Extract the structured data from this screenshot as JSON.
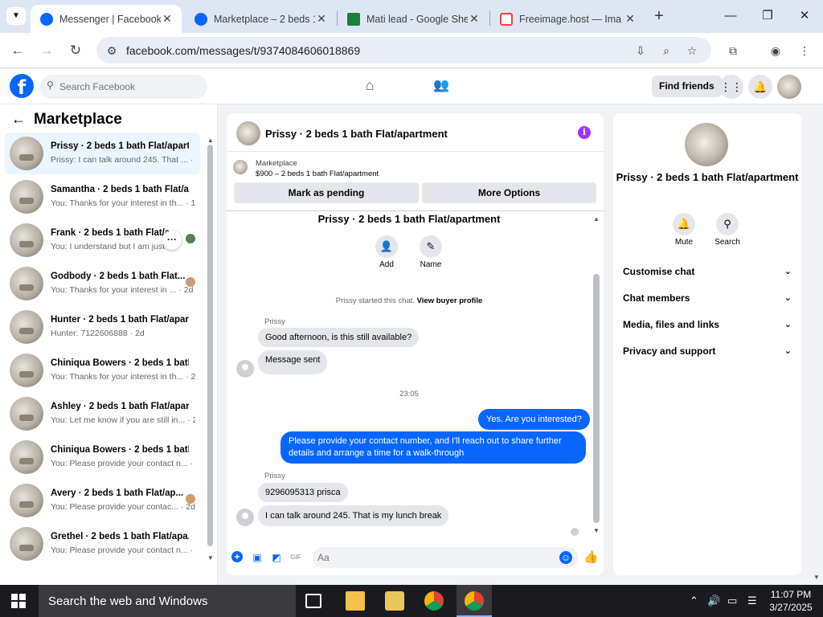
{
  "browser": {
    "tabs": [
      {
        "title": "Messenger | Facebook",
        "active": true,
        "favicon_color": "#0866ff"
      },
      {
        "title": "Marketplace – 2 beds 1",
        "active": false,
        "favicon_color": "#0866ff"
      },
      {
        "title": "Mati lead - Google She",
        "active": false,
        "favicon_color": "#188038"
      },
      {
        "title": "Freeimage.host — Ima",
        "active": false,
        "favicon_color": "#e8453c"
      }
    ],
    "url": "facebook.com/messages/t/9374084606018869"
  },
  "fb": {
    "search_placeholder": "Search Facebook",
    "find_friends": "Find friends"
  },
  "left": {
    "title": "Marketplace",
    "conversations": [
      {
        "name": "Prissy · 2 beds 1 bath Flat/apart...",
        "preview": "Prissy: I can talk around 245. That ... · 1m",
        "selected": true
      },
      {
        "name": "Samantha · 2 beds 1 bath Flat/a...",
        "preview": "You: Thanks for your interest in th... · 1m"
      },
      {
        "name": "Frank · 2 beds 1 bath Flat/ap",
        "preview": "You: I understand but I am just ..."
      },
      {
        "name": "Godbody · 2 beds 1 bath Flat...",
        "preview": "You: Thanks for your interest in ... · 2d"
      },
      {
        "name": "Hunter · 2 beds 1 bath Flat/apar...",
        "preview": "Hunter: 7122606888 · 2d"
      },
      {
        "name": "Chiniqua Bowers · 2 beds 1 bath...",
        "preview": "You: Thanks for your interest in th... · 2d"
      },
      {
        "name": "Ashley · 2 beds 1 bath Flat/apar...",
        "preview": "You: Let me know if you are still in... · 2d"
      },
      {
        "name": "Chiniqua Bowers · 2 beds 1 bath...",
        "preview": "You: Please provide your contact n... · 2d"
      },
      {
        "name": "Avery · 2 beds 1 bath Flat/ap...",
        "preview": "You: Please provide your contac... · 2d"
      },
      {
        "name": "Grethel · 2 beds 1 bath Flat/apa...",
        "preview": "You: Please provide your contact n... · 2d"
      }
    ]
  },
  "chat": {
    "header_title": "Prissy · 2 beds 1 bath Flat/apartment",
    "marketplace_label": "Marketplace",
    "listing": "$900 – 2 beds 1 bath Flat/apartment",
    "mark_pending": "Mark as pending",
    "more_options": "More Options",
    "conversation_title": "Prissy · 2 beds 1 bath Flat/apartment",
    "add_label": "Add",
    "name_label": "Name",
    "started_text": "Prissy started this chat.",
    "view_profile": "View buyer profile",
    "sender1": "Prissy",
    "msg1": "Good afternoon, is this still available?",
    "msg2": "Message sent",
    "time": "23:05",
    "out1": "Yes. Are you interested?",
    "out2": "Please provide your contact number, and I'll reach out to share further details and arrange a time for a walk-through",
    "sender2": "Prissy",
    "msg3": "9296095313 prisca",
    "msg4": "I can talk around 245. That is my lunch break",
    "input_placeholder": "Aa"
  },
  "right": {
    "name": "Prissy · 2 beds 1 bath Flat/apartment",
    "mute": "Mute",
    "search": "Search",
    "sections": [
      "Customise chat",
      "Chat members",
      "Media, files and links",
      "Privacy and support"
    ]
  },
  "taskbar": {
    "search": "Search the web and Windows",
    "time": "11:07 PM",
    "date": "3/27/2025"
  },
  "colors": {
    "accent": "#0866ff",
    "info": "#a033ff"
  }
}
